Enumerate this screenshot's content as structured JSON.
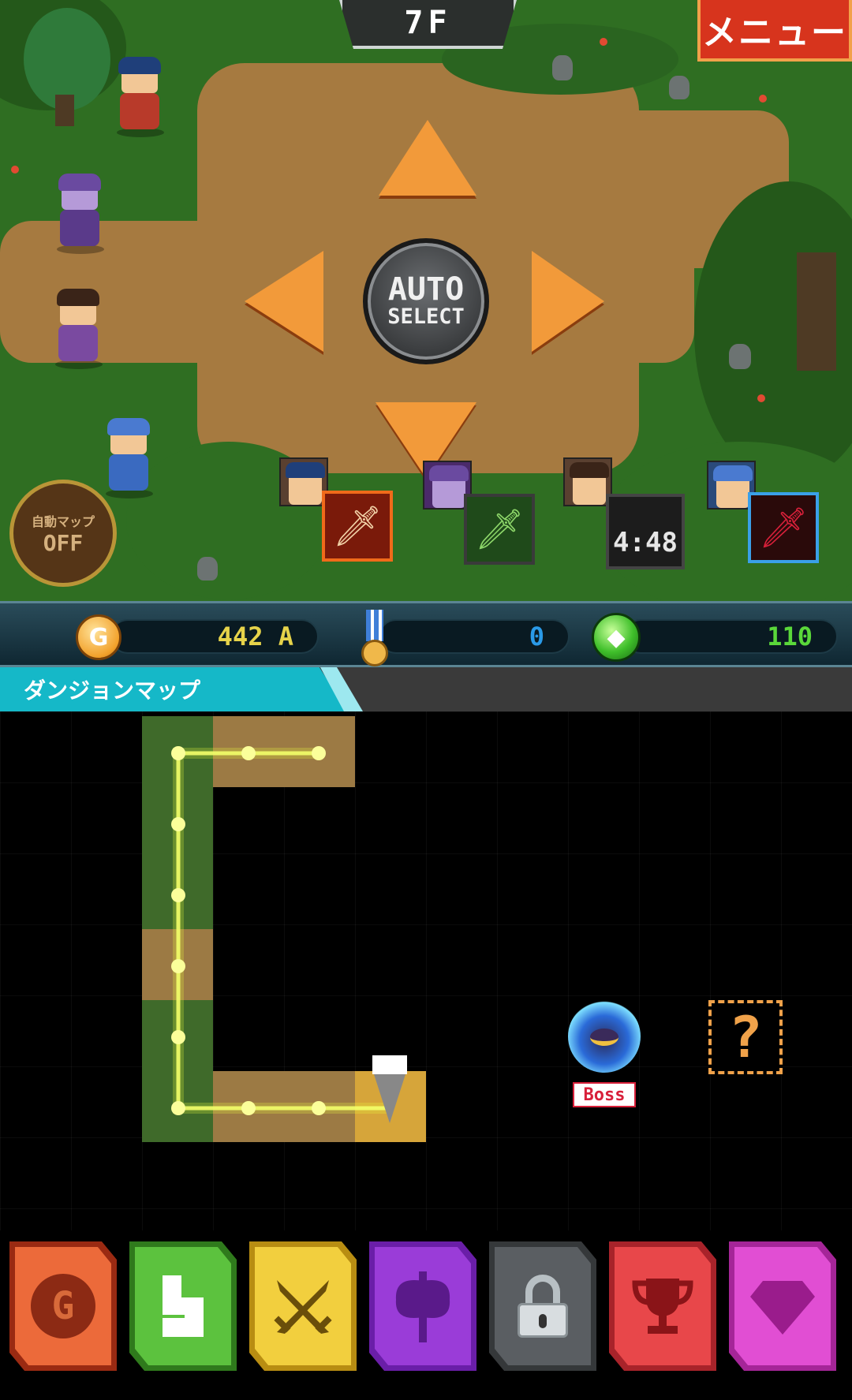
{
  "floor": "7F",
  "menu_label": "メニュー",
  "auto_select": {
    "line1": "AUTO",
    "line2": "SELECT"
  },
  "auto_map": {
    "label": "自動マップ",
    "state": "OFF"
  },
  "party_timer": "4:48",
  "resources": {
    "gold": "442 A",
    "medals": "0",
    "gems": "110"
  },
  "map_title": "ダンジョンマップ",
  "boss_label": "Boss",
  "unknown_label": "?",
  "tabs": [
    {
      "name": "tab-gold",
      "glyph": "G",
      "color": "#ec6a3a",
      "border": "#b8421e",
      "active": false,
      "icon": "gold-coin-icon"
    },
    {
      "name": "tab-dungeon",
      "glyph": "",
      "color": "#5cc23e",
      "border": "#2f7a1c",
      "active": true,
      "icon": "path-icon"
    },
    {
      "name": "tab-battle",
      "glyph": "⚔",
      "color": "#f2cf3e",
      "border": "#b88d12",
      "active": false,
      "icon": "crossed-swords-icon"
    },
    {
      "name": "tab-equipment",
      "glyph": "",
      "color": "#9a3cd8",
      "border": "#6a1ea8",
      "active": false,
      "icon": "axe-icon"
    },
    {
      "name": "tab-locked",
      "glyph": "",
      "color": "#5a5e62",
      "border": "#35383a",
      "active": false,
      "icon": "lock-icon"
    },
    {
      "name": "tab-ranking",
      "glyph": "🏆",
      "color": "#e8474a",
      "border": "#a8232a",
      "active": false,
      "icon": "trophy-icon"
    },
    {
      "name": "tab-shop",
      "glyph": "◆",
      "color": "#e14ed3",
      "border": "#a52598",
      "active": false,
      "icon": "diamond-icon"
    }
  ]
}
